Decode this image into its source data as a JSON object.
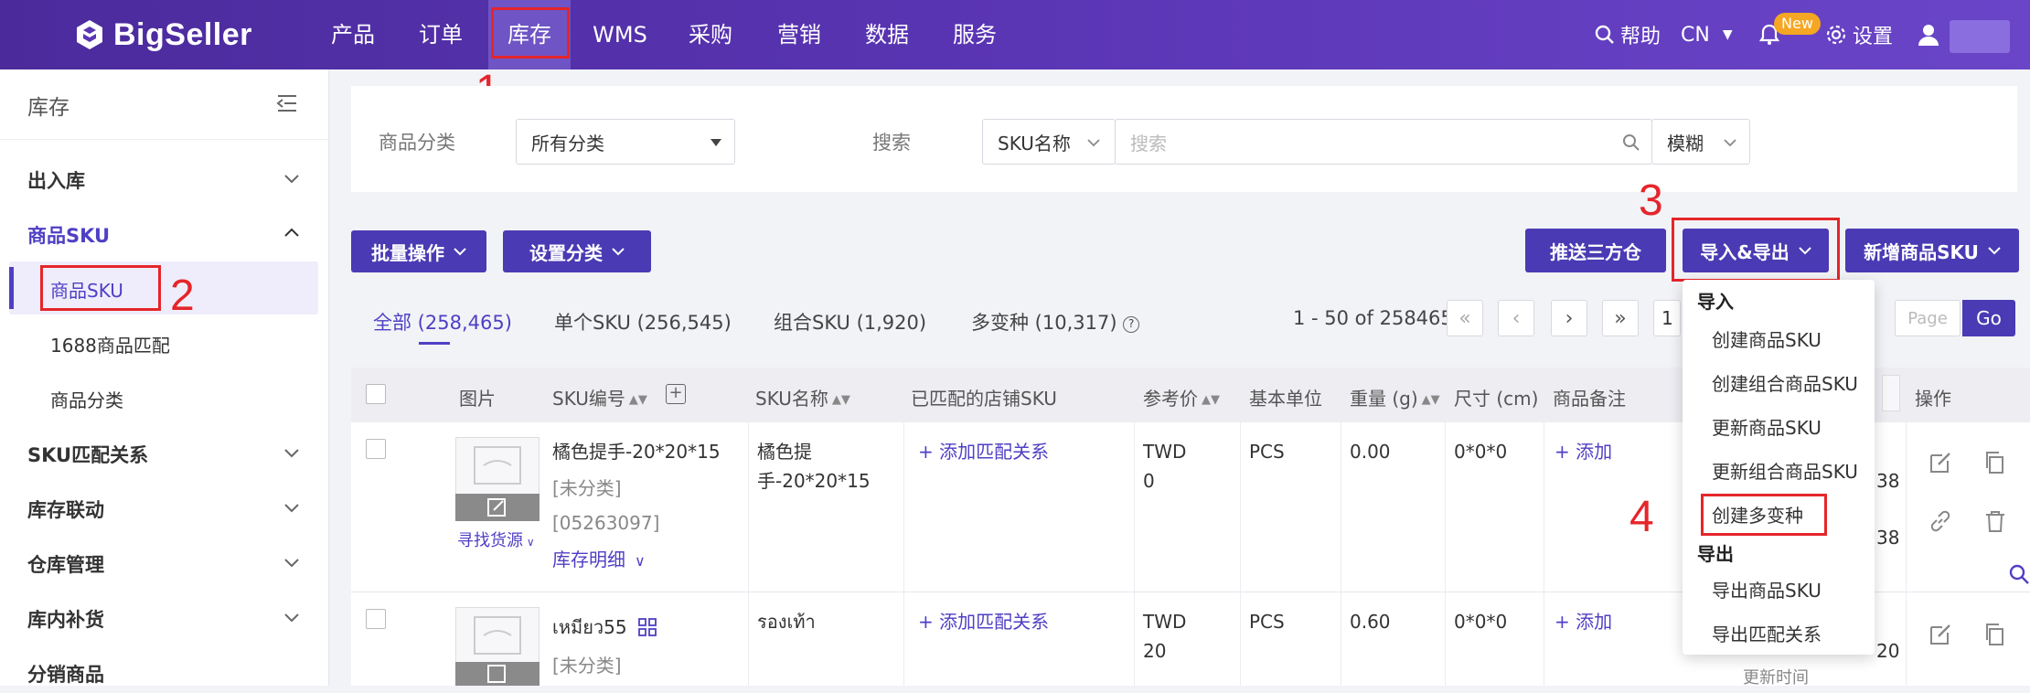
{
  "brand": {
    "name": "BigSeller"
  },
  "nav": {
    "items": [
      "产品",
      "订单",
      "库存",
      "WMS",
      "采购",
      "营销",
      "数据",
      "服务"
    ],
    "active": "库存",
    "help": "帮助",
    "lang": "CN",
    "new_badge": "New",
    "settings": "设置"
  },
  "sidebar": {
    "title": "库存",
    "groups": [
      {
        "label": "出入库"
      },
      {
        "label": "商品SKU",
        "subs": [
          "商品SKU",
          "1688商品匹配",
          "商品分类"
        ]
      },
      {
        "label": "SKU匹配关系"
      },
      {
        "label": "库存联动"
      },
      {
        "label": "仓库管理"
      },
      {
        "label": "库内补货"
      },
      {
        "label": "分销商品"
      }
    ]
  },
  "filter": {
    "category_label": "商品分类",
    "category_value": "所有分类",
    "search_label": "搜索",
    "search_field": "SKU名称",
    "search_placeholder": "搜索",
    "match_mode": "模糊"
  },
  "toolbar": {
    "bulk": "批量操作",
    "set_category": "设置分类",
    "push": "推送三方仓",
    "import_export": "导入&导出",
    "add_sku": "新增商品SKU"
  },
  "tabs": [
    {
      "label": "全部 (258,465)"
    },
    {
      "label": "单个SKU (256,545)"
    },
    {
      "label": "组合SKU (1,920)"
    },
    {
      "label": "多变种 (10,317)"
    }
  ],
  "pagination": {
    "range": "1 - 50 of 258465",
    "page_input_value": "1",
    "page_placeholder": "Page",
    "go": "Go"
  },
  "table": {
    "headers": [
      "图片",
      "SKU编号",
      "SKU名称",
      "已匹配的店铺SKU",
      "参考价",
      "基本单位",
      "重量 (g)",
      "尺寸 (cm)",
      "商品备注",
      "操作"
    ],
    "rows": [
      {
        "sku_code": "橘色提手-20*20*15",
        "category": "[未分类]",
        "id": "[05263097]",
        "stock_detail": "库存明细",
        "find_source": "寻找货源",
        "sku_name_l1": "橘色提",
        "sku_name_l2": "手-20*20*15",
        "matched": "+ 添加匹配关系",
        "price_l1": "TWD",
        "price_l2": "0",
        "unit": "PCS",
        "weight": "0.00",
        "size": "0*0*0",
        "note": "+ 添加",
        "time_a": "38",
        "time_b": "38"
      },
      {
        "sku_code": "เหมียว55",
        "category": "[未分类]",
        "sku_name_l1": "รองเท้า",
        "matched": "+ 添加匹配关系",
        "price_l1": "TWD",
        "price_l2": "20",
        "unit": "PCS",
        "weight": "0.60",
        "size": "0*0*0",
        "note": "+ 添加",
        "time_a": "20",
        "time_b": "更新时间"
      }
    ]
  },
  "dropdown": {
    "import_header": "导入",
    "import_items": [
      "创建商品SKU",
      "创建组合商品SKU",
      "更新商品SKU",
      "更新组合商品SKU",
      "创建多变种"
    ],
    "export_header": "导出",
    "export_items": [
      "导出商品SKU",
      "导出匹配关系"
    ]
  },
  "annotations": [
    "1",
    "2",
    "3",
    "4"
  ],
  "colors": {
    "nav": "#5a35b4",
    "accent": "#4a3ab3",
    "highlight": "#e5252a"
  }
}
